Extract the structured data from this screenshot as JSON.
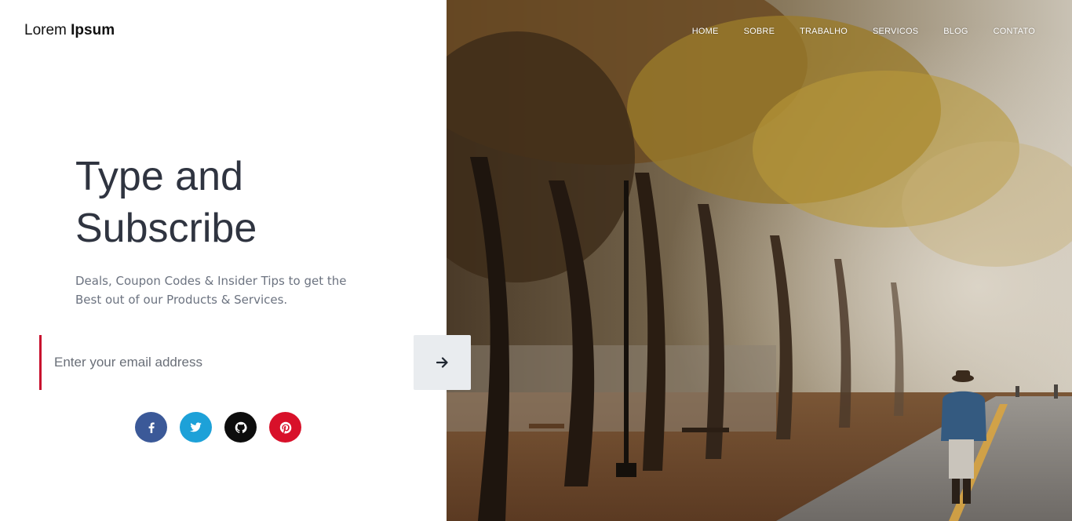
{
  "brand": {
    "name_light": "Lorem",
    "name_bold": "Ipsum"
  },
  "nav": {
    "items": [
      "HOME",
      "SOBRE",
      "TRABALHO",
      "SERVICOS",
      "BLOG",
      "CONTATO"
    ]
  },
  "hero": {
    "title_line1": "Type and",
    "title_line2": "Subscribe",
    "subtitle": "Deals, Coupon Codes & Insider Tips to get the Best out of our Products & Services."
  },
  "form": {
    "email_placeholder": "Enter your email address",
    "submit_icon": "arrow-right-icon"
  },
  "social": [
    {
      "name": "facebook-icon",
      "color": "#3b5998"
    },
    {
      "name": "twitter-icon",
      "color": "#1da1d8"
    },
    {
      "name": "github-icon",
      "color": "#0d0d0d"
    },
    {
      "name": "pinterest-icon",
      "color": "#d8112a"
    }
  ],
  "colors": {
    "accent": "#c8102e",
    "headline": "#2f3440",
    "muted": "#6c7380"
  }
}
